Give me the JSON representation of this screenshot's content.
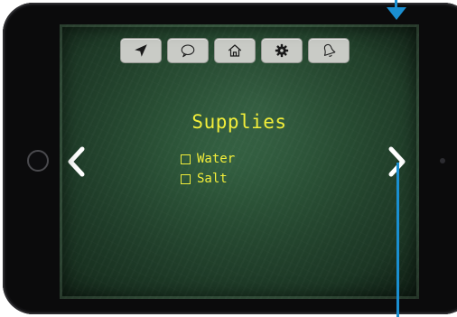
{
  "toolbar": {
    "buttons": [
      {
        "icon": "location-arrow-icon"
      },
      {
        "icon": "speech-bubble-icon"
      },
      {
        "icon": "home-icon"
      },
      {
        "icon": "gear-icon"
      },
      {
        "icon": "bell-icon"
      }
    ]
  },
  "main": {
    "title": "Supplies",
    "items": [
      {
        "label": "Water",
        "checked": false
      },
      {
        "label": "Salt",
        "checked": false
      }
    ]
  },
  "navigation": {
    "previous_icon": "chevron-left-icon",
    "next_icon": "chevron-right-icon"
  },
  "colors": {
    "chalk_yellow": "#f2ee3a",
    "board_green": "#2f5a3c",
    "button_gray": "#c9cbc6",
    "annotation_blue": "#1a8fd1"
  }
}
